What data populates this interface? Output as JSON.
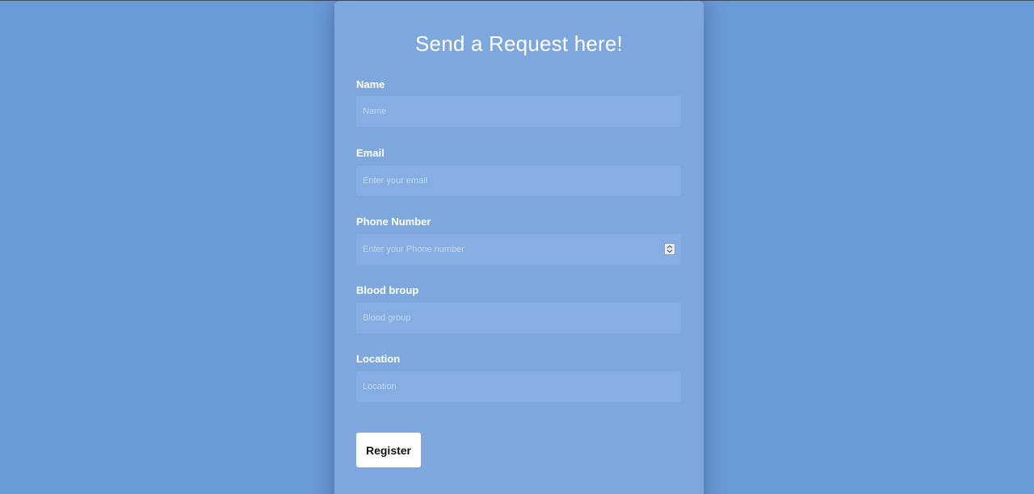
{
  "form": {
    "title": "Send a Request here!",
    "fields": [
      {
        "label": "Name",
        "placeholder": "Name",
        "value": ""
      },
      {
        "label": "Email",
        "placeholder": "Enter your email",
        "value": ""
      },
      {
        "label": "Phone Number",
        "placeholder": "Enter your Phone number",
        "value": ""
      },
      {
        "label": "Blood broup",
        "placeholder": "Blood group",
        "value": ""
      },
      {
        "label": "Location",
        "placeholder": "Location",
        "value": ""
      }
    ],
    "submit_label": "Register"
  },
  "icons": {
    "phone_spinner": "number-spinner-icon"
  },
  "colors": {
    "background": "#6a9ad8",
    "card": "#7ea7de",
    "input": "#86aee3",
    "text": "#ffffff",
    "button": "#ffffff"
  }
}
